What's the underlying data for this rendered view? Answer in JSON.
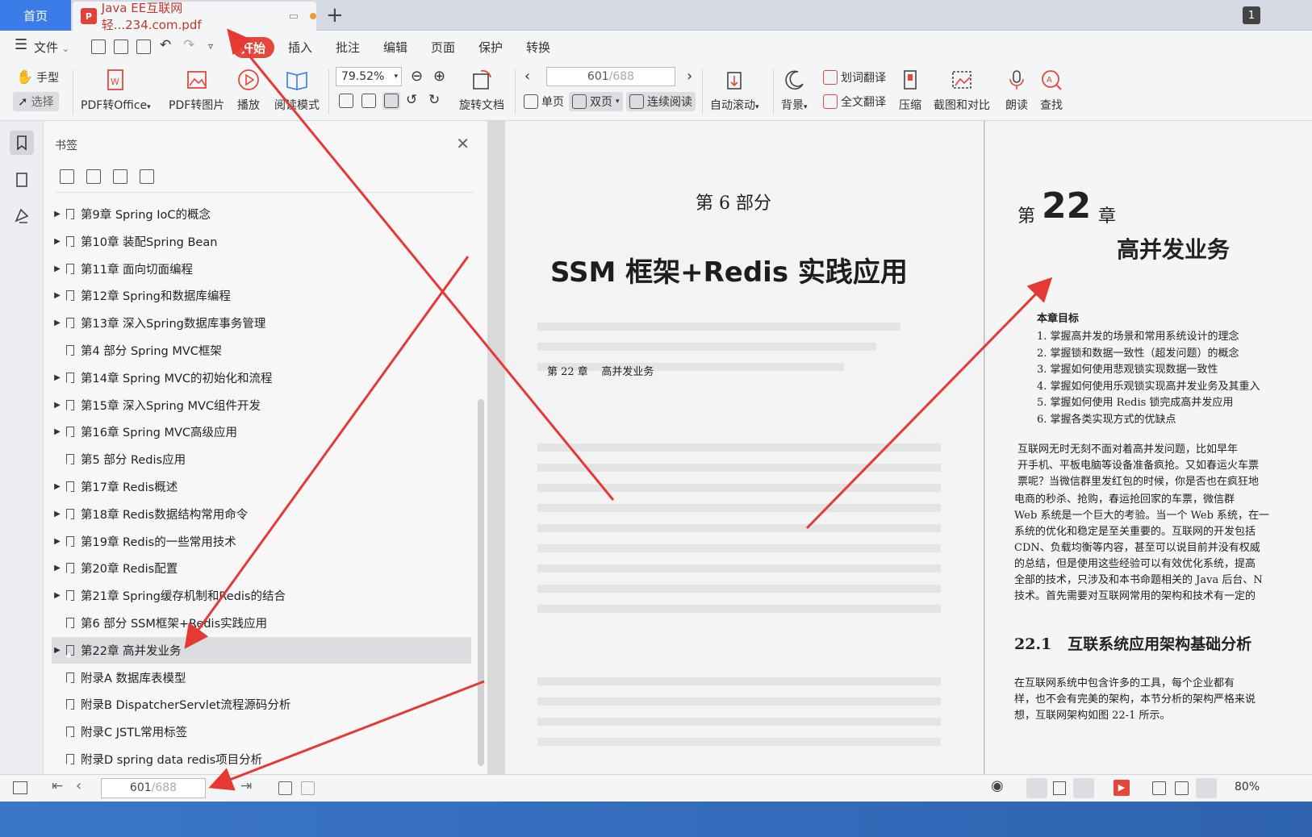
{
  "tabs": {
    "home": "首页",
    "document": "Java EE互联网轻...234.com.pdf",
    "new_tab": "+",
    "window_badge": "1"
  },
  "menu": {
    "file": "文件",
    "start": "开始",
    "insert": "插入",
    "annotate": "批注",
    "edit": "编辑",
    "page": "页面",
    "protect": "保护",
    "convert": "转换"
  },
  "toolbar": {
    "hand": "手型",
    "select": "选择",
    "pdf_to_office": "PDF转Office",
    "pdf_to_image": "PDF转图片",
    "play": "播放",
    "read_mode": "阅读模式",
    "zoom": "79.52%",
    "rotate_doc": "旋转文档",
    "page_current": "601",
    "page_total": "/688",
    "single_page": "单页",
    "double_page": "双页",
    "continuous": "连续阅读",
    "auto_scroll": "自动滚动",
    "background": "背景",
    "word_translate": "划词翻译",
    "full_translate": "全文翻译",
    "compress": "压缩",
    "screenshot_compare": "截图和对比",
    "read_aloud": "朗读",
    "find": "查找"
  },
  "bookmarks": {
    "title": "书签",
    "items": [
      {
        "label": "第9章 Spring IoC的概念",
        "expandable": true
      },
      {
        "label": "第10章 装配Spring Bean",
        "expandable": true
      },
      {
        "label": "第11章 面向切面编程",
        "expandable": true
      },
      {
        "label": "第12章 Spring和数据库编程",
        "expandable": true
      },
      {
        "label": "第13章 深入Spring数据库事务管理",
        "expandable": true
      },
      {
        "label": "第4 部分 Spring MVC框架",
        "expandable": false
      },
      {
        "label": "第14章 Spring MVC的初始化和流程",
        "expandable": true
      },
      {
        "label": "第15章 深入Spring MVC组件开发",
        "expandable": true
      },
      {
        "label": "第16章 Spring MVC高级应用",
        "expandable": true
      },
      {
        "label": "第5 部分 Redis应用",
        "expandable": false
      },
      {
        "label": "第17章 Redis概述",
        "expandable": true
      },
      {
        "label": "第18章 Redis数据结构常用命令",
        "expandable": true
      },
      {
        "label": "第19章 Redis的一些常用技术",
        "expandable": true
      },
      {
        "label": "第20章 Redis配置",
        "expandable": true
      },
      {
        "label": "第21章 Spring缓存机制和Redis的结合",
        "expandable": true
      },
      {
        "label": "第6 部分 SSM框架+Redis实践应用",
        "expandable": false
      },
      {
        "label": "第22章 高并发业务",
        "expandable": true,
        "selected": true
      },
      {
        "label": "附录A 数据库表模型",
        "expandable": false
      },
      {
        "label": "附录B DispatcherServlet流程源码分析",
        "expandable": false
      },
      {
        "label": "附录C JSTL常用标签",
        "expandable": false
      },
      {
        "label": "附录D spring data redis项目分析",
        "expandable": false
      }
    ]
  },
  "left_page": {
    "part": "第 6 部分",
    "title": "SSM 框架+Redis 实践应用",
    "toc_entry": "第 22 章    高并发业务"
  },
  "right_page": {
    "chapter_prefix": "第",
    "chapter_num": "22",
    "chapter_suffix": "章",
    "chapter_title": "高并发业务",
    "goals_heading": "本章目标",
    "goals": [
      "1. 掌握高并发的场景和常用系统设计的理念",
      "2. 掌握锁和数据一致性（超发问题）的概念",
      "3. 掌握如何使用悲观锁实现数据一致性",
      "4. 掌握如何使用乐观锁实现高并发业务及其重入",
      "5. 掌握如何使用 Redis 锁完成高并发应用",
      "6. 掌握各类实现方式的优缺点"
    ],
    "para1": [
      "互联网无时无刻不面对着高并发问题，比如早年",
      "开手机、平板电脑等设备准备疯抢。又如春运火车票",
      "票呢？当微信群里发红包的时候，你是否也在疯狂地"
    ],
    "para2": [
      "电商的秒杀、抢购，春运抢回家的车票，微信群",
      "Web 系统是一个巨大的考验。当一个 Web 系统，在一",
      "系统的优化和稳定是至关重要的。互联网的开发包括",
      "CDN、负载均衡等内容，甚至可以说目前并没有权威",
      "的总结，但是使用这些经验可以有效优化系统，提高",
      "全部的技术，只涉及和本书命题相关的 Java 后台、N",
      "技术。首先需要对互联网常用的架构和技术有一定的"
    ],
    "section": "22.1   互联系统应用架构基础分析",
    "para3": [
      "在互联网系统中包含许多的工具，每个企业都有",
      "样，也不会有完美的架构，本节分析的架构严格来说",
      "想，互联网架构如图 22-1 所示。"
    ]
  },
  "statusbar": {
    "page_current": "601",
    "page_total": "/688",
    "zoom": "80%"
  },
  "colors": {
    "accent_blue": "#3b7ce8",
    "start_red": "#e4483b",
    "arrow_red": "#e53935"
  }
}
